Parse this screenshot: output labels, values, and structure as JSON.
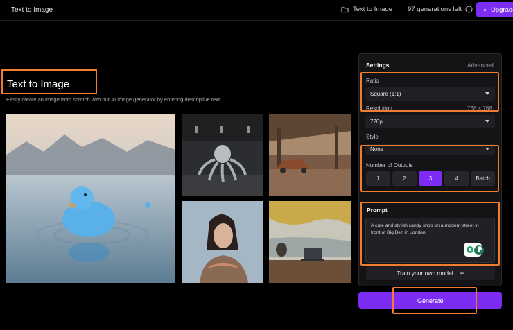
{
  "topbar": {
    "title": "Text to Image",
    "crumb": "Text to Image",
    "generations": "97 generations left",
    "upgrade": "Upgrade"
  },
  "hero": {
    "title": "Text to Image",
    "subtitle": "Easily create an image from scratch with our AI image generator by entering descriptive text."
  },
  "gallery": {
    "images": [
      {
        "name": "blue-duck-lake-image"
      },
      {
        "name": "octopus-image"
      },
      {
        "name": "abandoned-car-image"
      },
      {
        "name": "portrait-woman-image"
      },
      {
        "name": "laptop-lake-image"
      }
    ]
  },
  "settings": {
    "heading": "Settings",
    "advanced": "Advanced",
    "ratio_label": "Ratio",
    "ratio_value": "Square (1:1)",
    "resolution_label": "Resolution",
    "resolution_dims": "768 × 768",
    "resolution_value": "720p",
    "style_label": "Style",
    "style_value": "None",
    "outputs_label": "Number of Outputs",
    "outputs": [
      "1",
      "2",
      "3",
      "4",
      "Batch"
    ],
    "outputs_selected": "3",
    "prompt_label": "Prompt",
    "prompt_value": "A cute and stylish candy shop on a modern street in front of Big Ben in London",
    "train_label": "Train your own model",
    "generate_label": "Generate"
  },
  "colors": {
    "accent": "#7c2cf3",
    "highlight": "#f07c2f"
  }
}
